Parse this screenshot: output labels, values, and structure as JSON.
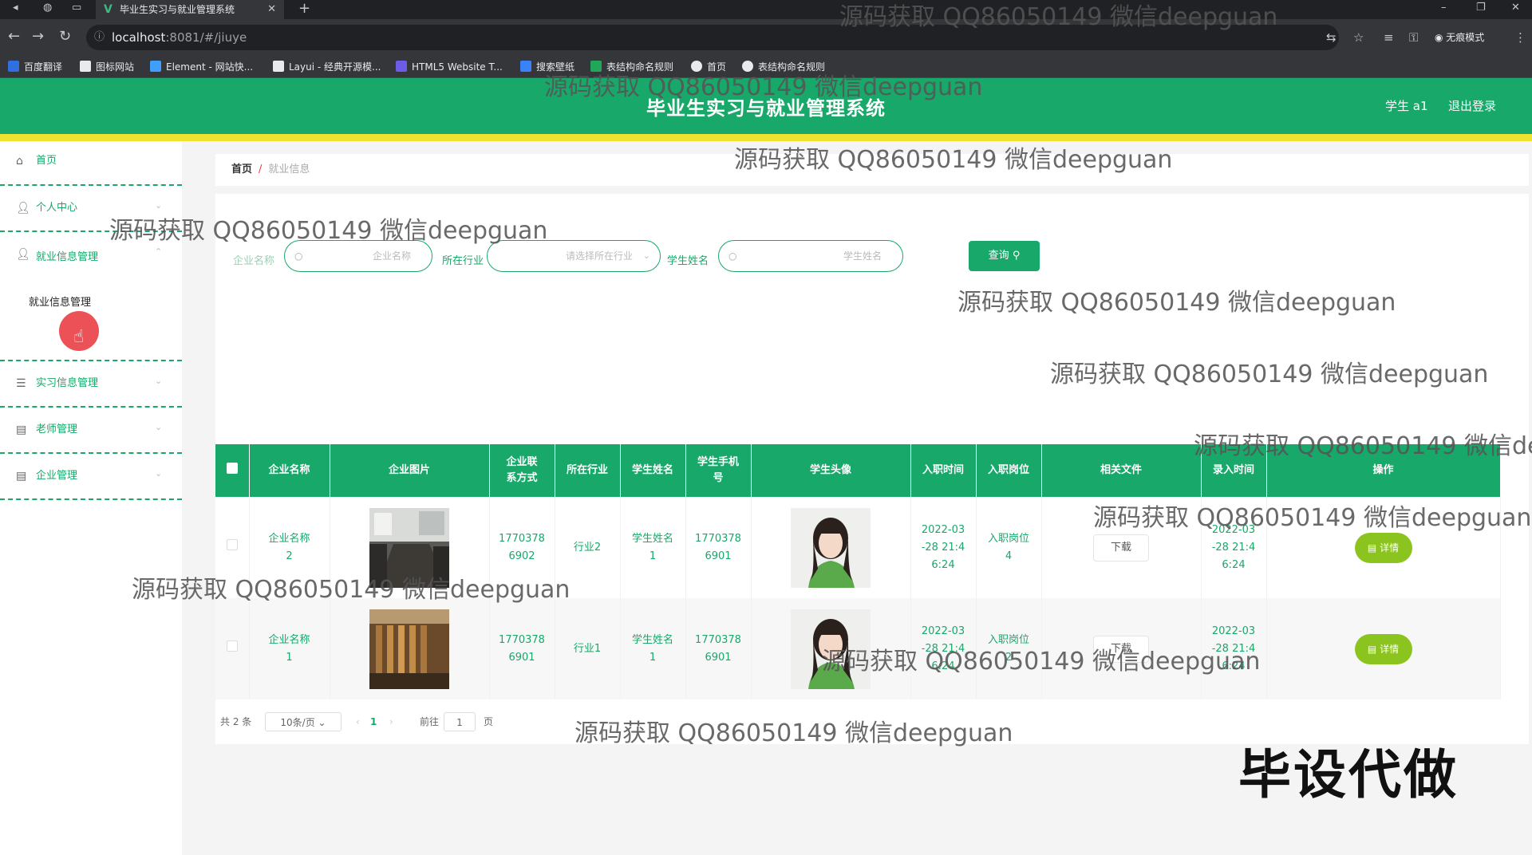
{
  "browser": {
    "tab_title": "毕业生实习与就业管理系统",
    "url_host": "localhost",
    "url_path": ":8081/#/jiuye",
    "incognito_label": "无痕模式",
    "bookmarks": [
      "百度翻译",
      "图标网站",
      "Element - 网站快...",
      "Layui - 经典开源模...",
      "HTML5 Website T...",
      "搜索壁纸",
      "表结构命名规则",
      "首页",
      "表结构命名规则"
    ]
  },
  "header": {
    "title": "毕业生实习与就业管理系统",
    "user": "学生 a1",
    "logout": "退出登录"
  },
  "sidebar": {
    "items": [
      {
        "label": "首页",
        "icon": "home-icon"
      },
      {
        "label": "个人中心",
        "icon": "user-icon"
      },
      {
        "label": "就业信息管理",
        "icon": "user-icon"
      },
      {
        "label": "实习信息管理",
        "icon": "list-icon"
      },
      {
        "label": "老师管理",
        "icon": "briefcase-icon"
      },
      {
        "label": "企业管理",
        "icon": "briefcase-icon"
      }
    ],
    "submenu": "就业信息管理"
  },
  "breadcrumb": {
    "home": "首页",
    "sep": "/",
    "current": "就业信息"
  },
  "filters": {
    "company_label": "企业名称",
    "company_placeholder": "企业名称",
    "industry_label": "所在行业",
    "industry_placeholder": "请选择所在行业",
    "student_label": "学生姓名",
    "student_placeholder": "学生姓名",
    "query_button": "查询"
  },
  "table": {
    "columns": [
      "企业名称",
      "企业图片",
      "企业联系方式",
      "所在行业",
      "学生姓名",
      "学生手机号",
      "学生头像",
      "入职时间",
      "入职岗位",
      "相关文件",
      "录入时间",
      "操作"
    ],
    "rows": [
      {
        "company": "企业名称2",
        "contact": "17703786902",
        "industry": "行业2",
        "student": "学生姓名1",
        "phone": "17703786901",
        "join_time": "2022-03-28 21:46:24",
        "position": "入职岗位4",
        "file": "下载",
        "entry_time": "2022-03-28 21:46:24",
        "action": "详情"
      },
      {
        "company": "企业名称1",
        "contact": "17703786901",
        "industry": "行业1",
        "student": "学生姓名1",
        "phone": "17703786901",
        "join_time": "2022-03-28 21:46:24",
        "position": "入职岗位2",
        "file": "下载",
        "entry_time": "2022-03-28 21:46:24",
        "action": "详情"
      }
    ]
  },
  "pagination": {
    "total": "共 2 条",
    "page_size": "10条/页",
    "current_page": "1",
    "goto_label": "前往",
    "goto_value": "1",
    "page_unit": "页"
  },
  "watermark": {
    "text": "源码获取 QQ86050149 微信deepguan",
    "text_cut": "源码获取 QQ86050149 微信de",
    "corner": "毕设代做"
  }
}
